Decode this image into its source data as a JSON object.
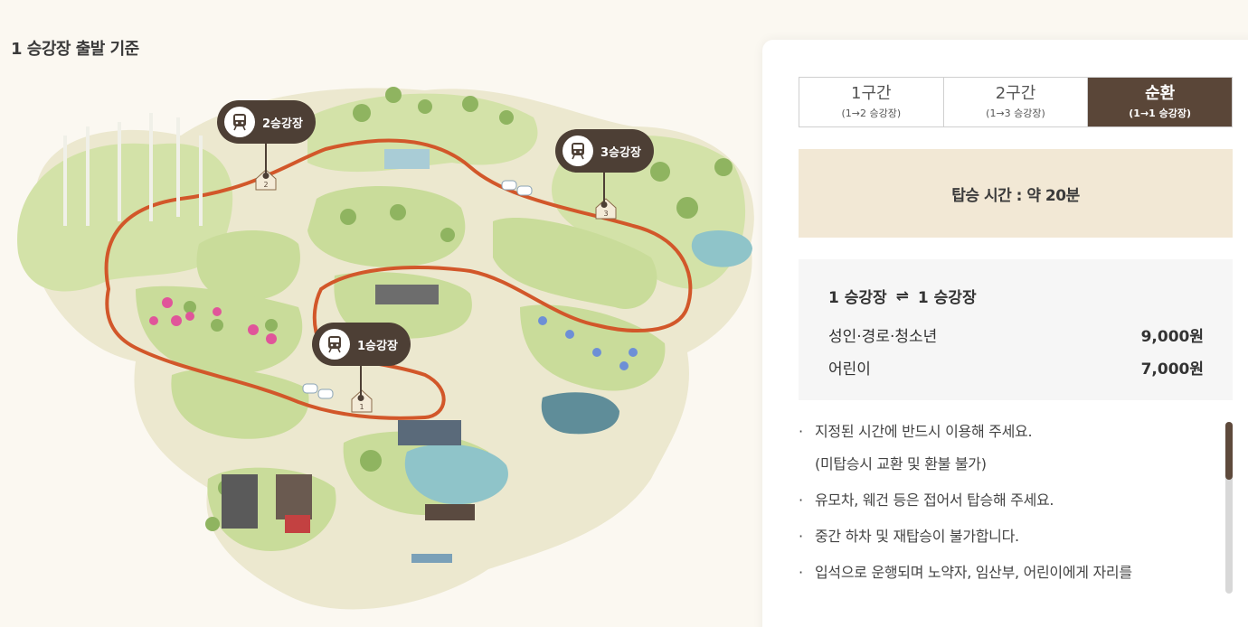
{
  "heading": "1 승강장 출발 기준",
  "stations": [
    {
      "label": "1승강장",
      "marker": "1"
    },
    {
      "label": "2승강장",
      "marker": "2"
    },
    {
      "label": "3승강장",
      "marker": "3"
    }
  ],
  "tabs": [
    {
      "label": "1구간",
      "sub": "(1→2 승강장)",
      "active": false
    },
    {
      "label": "2구간",
      "sub": "(1→3 승강장)",
      "active": false
    },
    {
      "label": "순환",
      "sub": "(1→1 승강장)",
      "active": true
    }
  ],
  "ride_time": "탑승 시간 : 약 20분",
  "fare": {
    "from": "1 승강장",
    "arrow": "⇌",
    "to": "1 승강장",
    "rows": [
      {
        "label": "성인·경로·청소년",
        "price": "9,000원"
      },
      {
        "label": "어린이",
        "price": "7,000원"
      }
    ]
  },
  "notes": [
    {
      "lines": [
        "지정된 시간에 반드시 이용해 주세요.",
        "(미탑승시 교환 및 환불 불가)"
      ]
    },
    {
      "lines": [
        "유모차, 웨건 등은 접어서 탑승해 주세요."
      ]
    },
    {
      "lines": [
        "중간 하차 및 재탑승이 불가합니다."
      ]
    },
    {
      "lines": [
        "입석으로 운행되며 노약자, 임산부, 어린이에게 자리를"
      ]
    }
  ],
  "colors": {
    "accent": "#5a4638",
    "route": "#d2572a",
    "ground": "#ece8cf",
    "grass": "#c9dc9a",
    "time_bg": "#f2e8d5"
  },
  "icons": {
    "station_icon": "train-icon",
    "bullet": "·"
  }
}
